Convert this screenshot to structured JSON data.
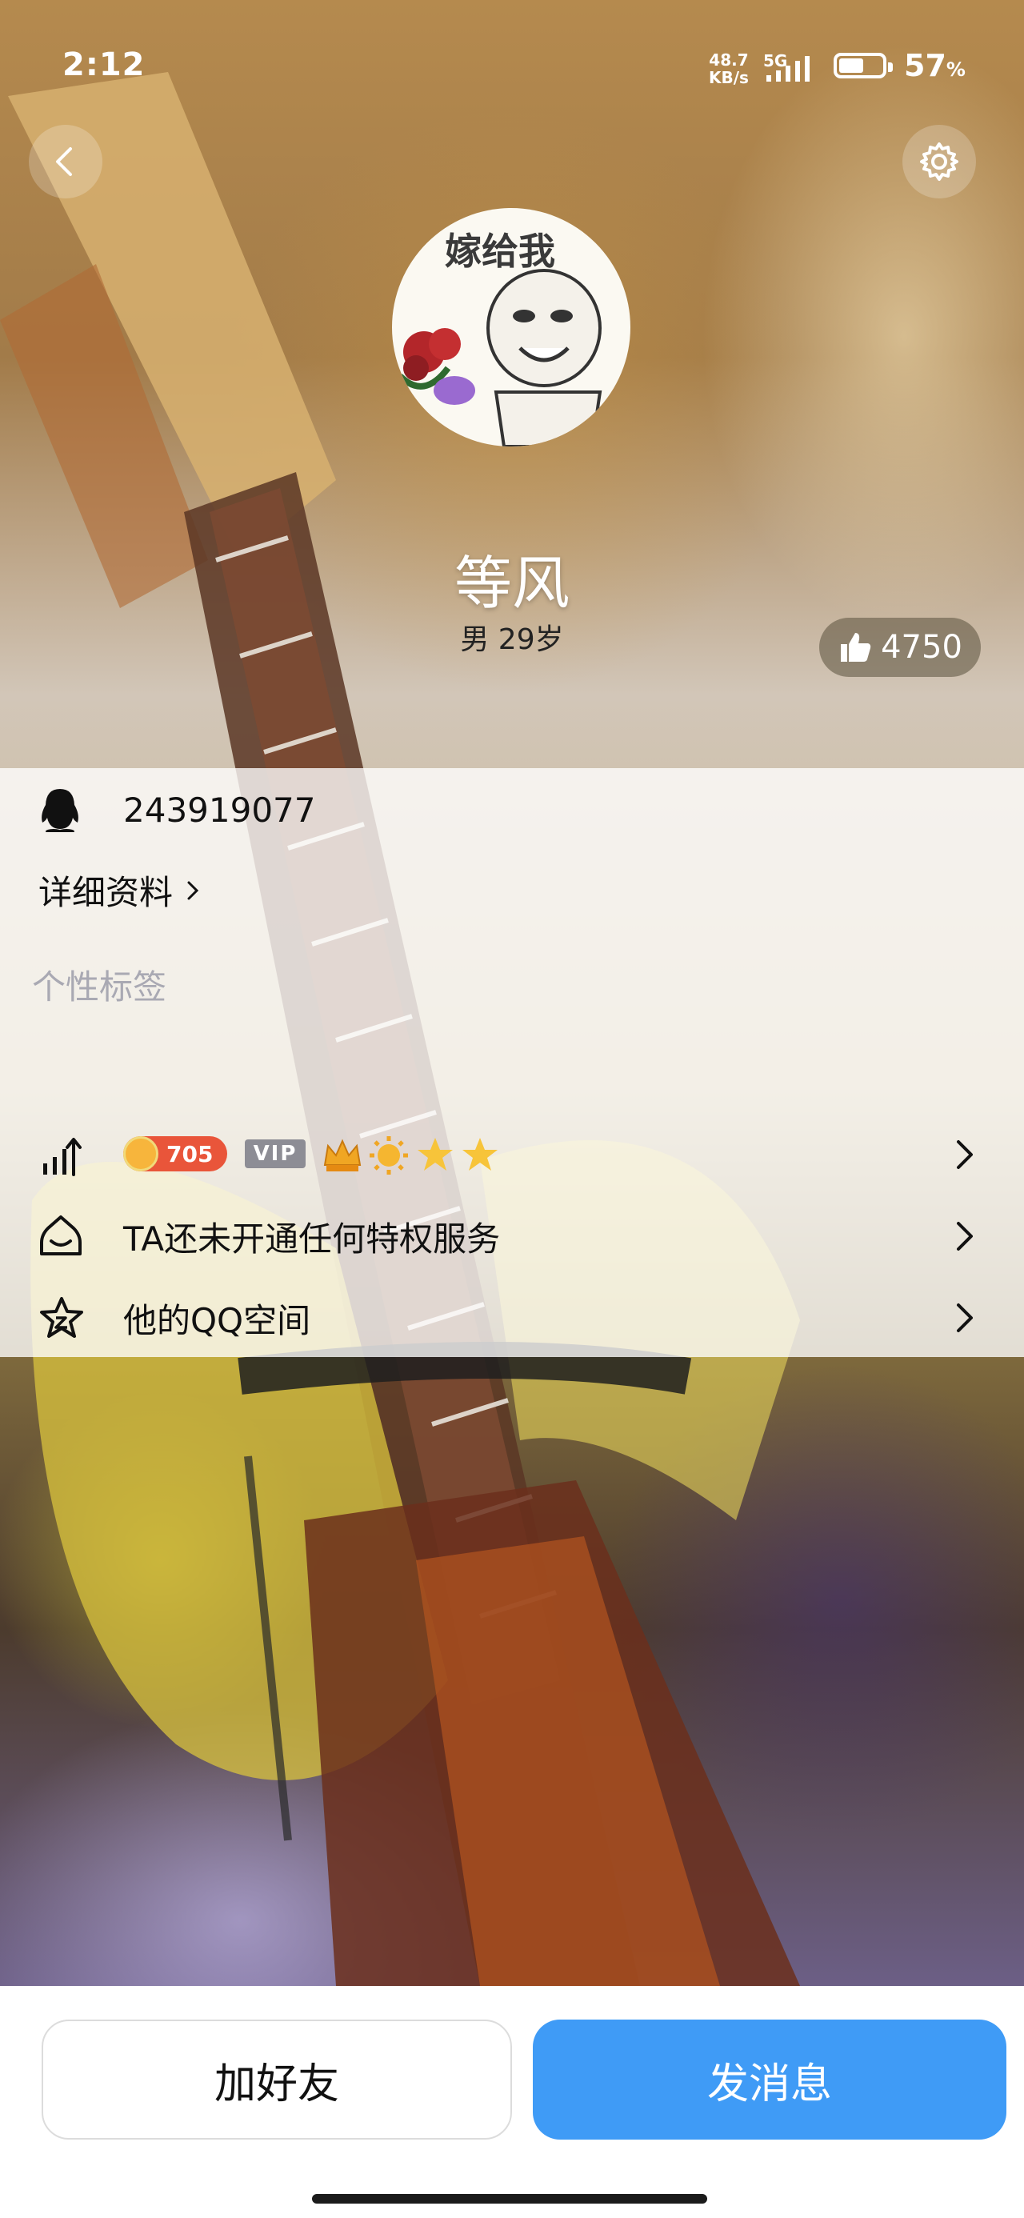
{
  "status_bar": {
    "time": "2:12",
    "net_speed_value": "48.7",
    "net_speed_unit": "KB/s",
    "network": "5G",
    "battery_percent": "57",
    "battery_percent_sign": "%",
    "battery_level": 0.57
  },
  "nav": {
    "back_icon": "chevron-left-icon",
    "settings_icon": "gear-icon"
  },
  "profile": {
    "avatar_caption": "嫁给我",
    "name": "等风",
    "gender_age": "男 29岁",
    "likes": "4750"
  },
  "info": {
    "qq_number": "243919077",
    "detail_link": "详细资料",
    "tags_placeholder": "个性标签",
    "level_number": "705",
    "vip_label": "VIP",
    "privilege_text": "TA还未开通任何特权服务",
    "qzone_text": "他的QQ空间"
  },
  "actions": {
    "add_friend": "加好友",
    "send_message": "发消息"
  },
  "colors": {
    "primary_button": "#3f9bf6",
    "level_badge": "#e9553a",
    "vip_badge": "#8d8d95"
  }
}
